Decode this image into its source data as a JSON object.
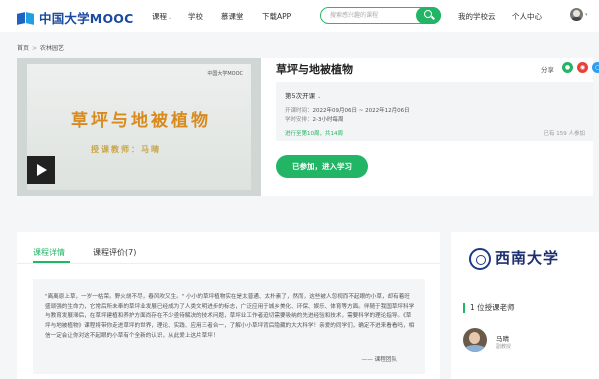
{
  "header": {
    "logo_text": "中国大学MOOC",
    "nav": [
      "课程",
      "学校",
      "慕课堂",
      "下载APP"
    ],
    "search_placeholder": "搜索感兴趣的课程",
    "user_links": [
      "我的学校云",
      "个人中心"
    ],
    "accent_color": "#21b565"
  },
  "breadcrumb": [
    "首页",
    "农林园艺"
  ],
  "course": {
    "title": "草坪与地被植物",
    "video_logo": "中国大学MOOC",
    "video_title": "草坪与地被植物",
    "video_teacher": "授课教师：马晴",
    "share_label": "分享",
    "share_icons": [
      "wechat-icon",
      "weibo-icon",
      "qq-icon"
    ],
    "term_label": "第5次开课",
    "start_time_label": "开课时间：",
    "start_time": "2022年09月06日 ~ 2022年12月06日",
    "schedule_label": "学时安排：",
    "schedule": "2-3小时每周",
    "progress_text": "进行至第10周，共14周",
    "enrolled_text": "已有 159 人参加",
    "join_button": "已参加，进入学习"
  },
  "tabs": [
    "课程详情",
    "课程评价(7)"
  ],
  "intro": {
    "text": "\"离离原上草，一岁一枯荣。野火烧不尽，春风吹又生。\" 小小的草坪植物实在是太普通、太朴素了，然而，这些被人忽视而不起眼的小草，却有着旺盛顽强的生命力，它常后所未奉的草坪业发展已经成为了人类文明进步的标志，广泛应用于城乡美化、环保、娱乐、体育等方面。伴随于我国草坪科学与教育发展滞后，在草坪建植和养护方面尚存在不少亟待解决的技术问题，草坪业工作者迫切需要吸纳的先进经验和技术，需要科学的理论指导。《草坪与地被植物》课程将带你走进草坪的世界，理论、实践、应用三者合一，了解小小草坪背后隐藏的大大科学！亲爱的同学们，确定不进来看看吗，相信一定会让你对这不起眼的小草有个全新的认识，从此爱上这片草坪！",
    "signature": "—— 课程团队"
  },
  "sidebar": {
    "university_name": "西南大学",
    "teacher_count": "1 位授课老师",
    "teacher_name": "马晴",
    "teacher_role": "副教授"
  }
}
